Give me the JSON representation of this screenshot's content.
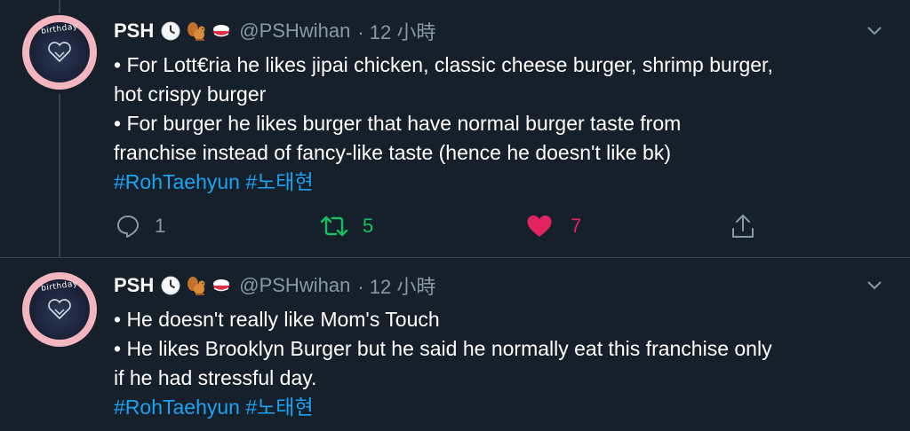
{
  "tweets": [
    {
      "user": {
        "name": "PSH",
        "handle": "@PSHwihan",
        "time": "· 12 小時",
        "avatar_text": "birthday",
        "status_icons": [
          "clock-icon",
          "squirrel-icon",
          "rice-bowl-icon"
        ]
      },
      "lines": [
        "• For Lott€ria he likes jipai chicken, classic cheese burger, shrimp burger,",
        "hot crispy burger",
        "• For burger he likes burger that have normal burger taste from",
        "franchise instead of fancy-like taste (hence he doesn't like bk)"
      ],
      "hashtags": [
        "#RohTaehyun",
        "#노태현"
      ],
      "actions": {
        "reply_count": "1",
        "retweet_count": "5",
        "like_count": "7"
      }
    },
    {
      "user": {
        "name": "PSH",
        "handle": "@PSHwihan",
        "time": "· 12 小時",
        "avatar_text": "birthday",
        "status_icons": [
          "clock-icon",
          "squirrel-icon",
          "rice-bowl-icon"
        ]
      },
      "lines": [
        "• He doesn't really like Mom's Touch",
        "• He likes Brooklyn Burger but he said he normally eat this franchise only",
        "if he had stressful day."
      ],
      "hashtags": [
        "#RohTaehyun",
        "#노태현"
      ]
    }
  ],
  "colors": {
    "background": "#15202b",
    "secondary_text": "#8899a6",
    "hashtag": "#1da1f2",
    "retweet": "#17bf63",
    "like": "#e0245e",
    "avatar_ring": "#f3b5be"
  }
}
